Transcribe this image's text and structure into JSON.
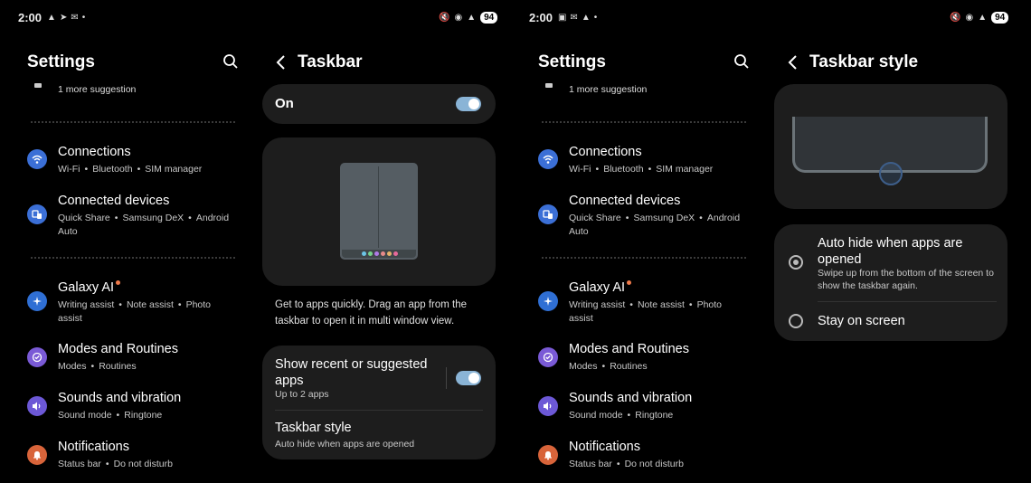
{
  "status_left": {
    "time": "2:00"
  },
  "status_right": {
    "time": "2:00"
  },
  "battery": "94",
  "settings": {
    "title": "Settings",
    "suggestion": "1 more suggestion",
    "items": [
      {
        "title": "Connections",
        "subs": [
          "Wi-Fi",
          "Bluetooth",
          "SIM manager"
        ]
      },
      {
        "title": "Connected devices",
        "subs": [
          "Quick Share",
          "Samsung DeX",
          "Android Auto"
        ]
      },
      {
        "title": "Galaxy AI",
        "subs": [
          "Writing assist",
          "Note assist",
          "Photo assist"
        ]
      },
      {
        "title": "Modes and Routines",
        "subs": [
          "Modes",
          "Routines"
        ]
      },
      {
        "title": "Sounds and vibration",
        "subs": [
          "Sound mode",
          "Ringtone"
        ]
      },
      {
        "title": "Notifications",
        "subs": [
          "Status bar",
          "Do not disturb"
        ]
      }
    ]
  },
  "taskbar": {
    "title": "Taskbar",
    "master_label": "On",
    "description": "Get to apps quickly. Drag an app from the taskbar to open it in multi window view.",
    "show_recent_title": "Show recent or suggested apps",
    "show_recent_sub": "Up to 2 apps",
    "style_title": "Taskbar style",
    "style_sub": "Auto hide when apps are opened"
  },
  "taskbar_style": {
    "title": "Taskbar style",
    "option1_title": "Auto hide when apps are opened",
    "option1_sub": "Swipe up from the bottom of the screen to show the taskbar again.",
    "option2_title": "Stay on screen"
  },
  "colors": {
    "card": "#1d1d1d",
    "toggle": "#8ab4d6",
    "connections": "#3b6fd6",
    "connected_devices": "#3b6fd6",
    "galaxy_ai": "#2f6fd4",
    "modes": "#7a5ad6",
    "sounds": "#6c58d6",
    "notifications": "#d8643a",
    "badge": "#f07a4a"
  }
}
